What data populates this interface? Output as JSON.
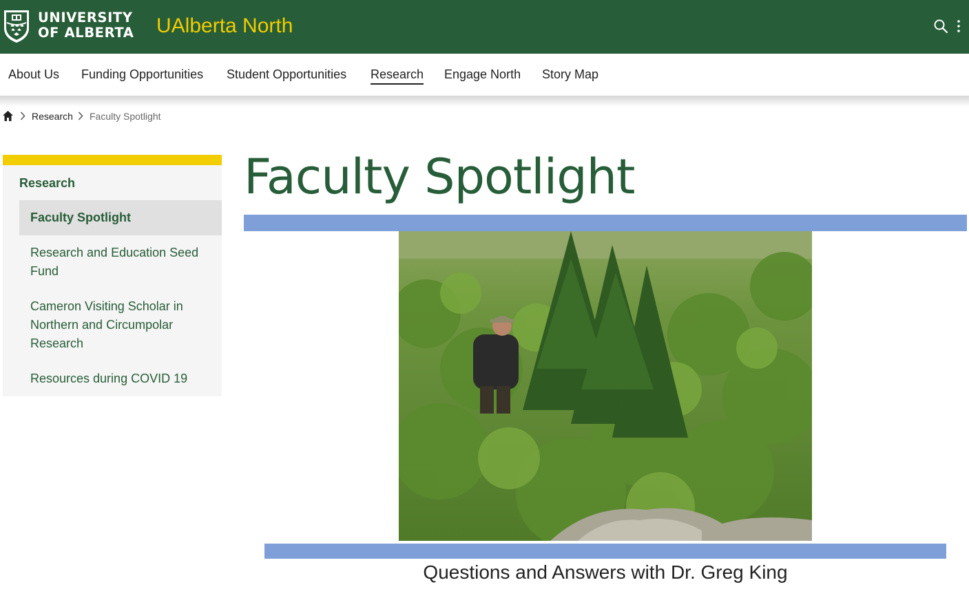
{
  "header": {
    "university_line1": "UNIVERSITY",
    "university_line2": "OF ALBERTA",
    "site_title": "UAlberta North",
    "search_icon": "search-icon",
    "menu_icon": "kebab-menu-icon",
    "colors": {
      "brand_green": "#275d38",
      "brand_gold": "#f2cd00"
    }
  },
  "nav": {
    "items": [
      {
        "label": "About Us",
        "active": false
      },
      {
        "label": "Funding Opportunities",
        "active": false
      },
      {
        "label": "Student Opportunities",
        "active": false
      },
      {
        "label": "Research",
        "active": true
      },
      {
        "label": "Engage North",
        "active": false
      },
      {
        "label": "Story Map",
        "active": false
      }
    ]
  },
  "breadcrumb": {
    "home_icon": "home-icon",
    "items": [
      "Research",
      "Faculty Spotlight"
    ]
  },
  "sidebar": {
    "heading": "Research",
    "items": [
      {
        "label": "Faculty Spotlight",
        "active": true
      },
      {
        "label": "Research and Education Seed Fund",
        "active": false
      },
      {
        "label": "Cameron Visiting Scholar in Northern and Circumpolar Research",
        "active": false
      },
      {
        "label": "Resources during COVID 19",
        "active": false
      }
    ]
  },
  "main": {
    "title": "Faculty Spotlight",
    "subtitle": "Questions and Answers with Dr. Greg King",
    "accent_band_color": "#7f9fd8"
  }
}
